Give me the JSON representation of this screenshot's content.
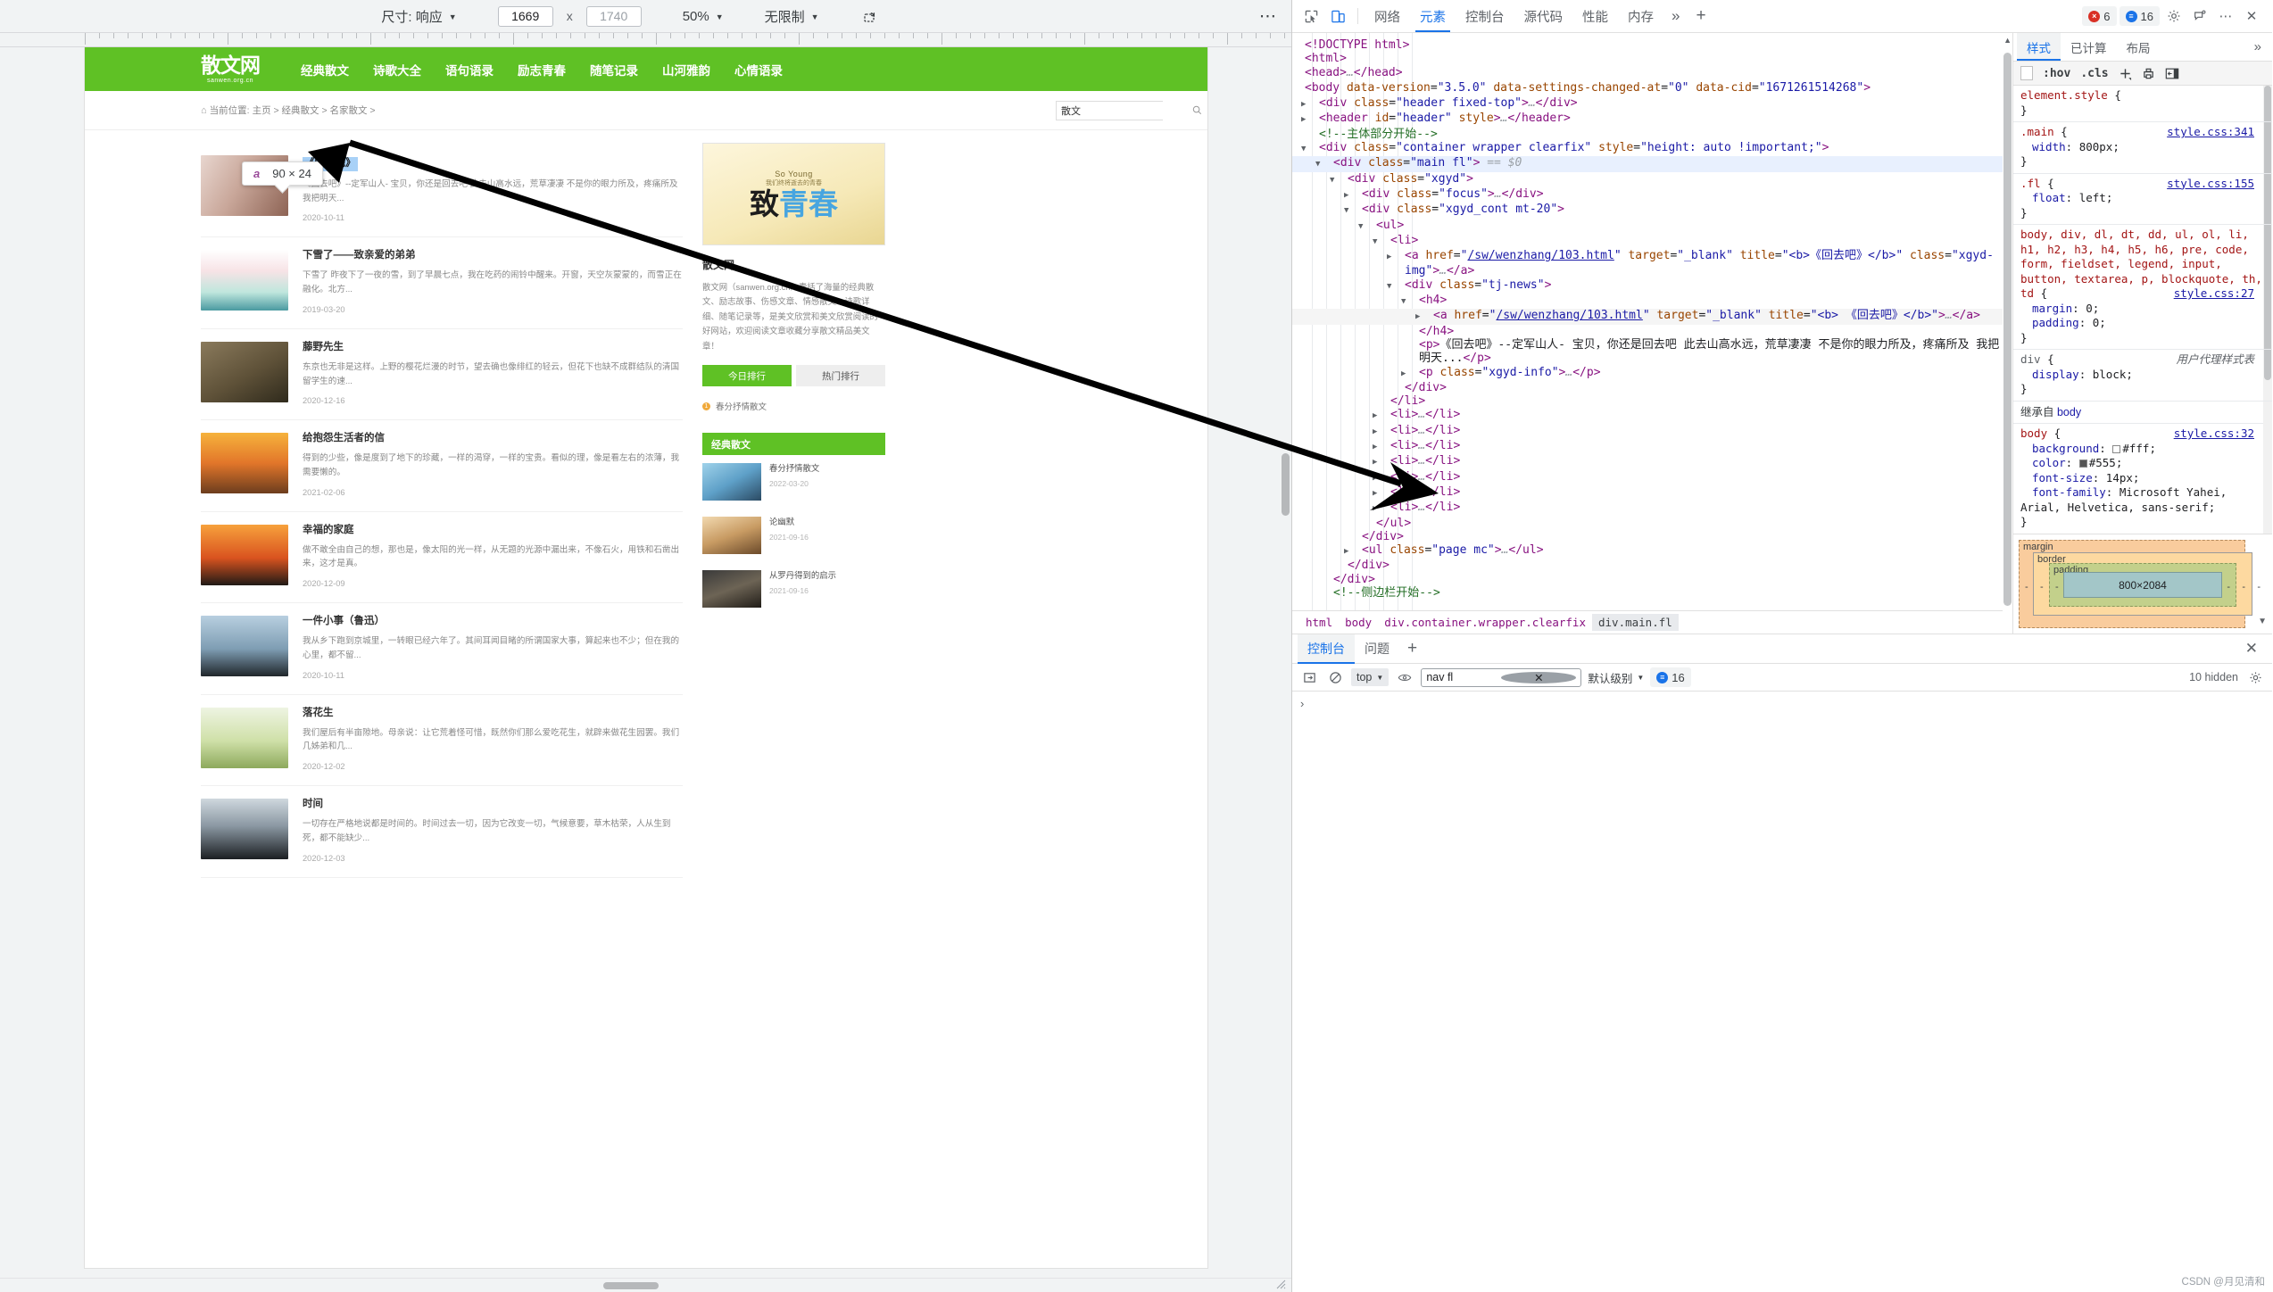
{
  "device_toolbar": {
    "size_label": "尺寸: 响应",
    "width_value": "1669",
    "height_placeholder": "1740",
    "multiply": "x",
    "zoom_label": "50%",
    "throttle_label": "无限制",
    "rotate_icon": "rotate-device-icon",
    "more_icon": "more-options-icon"
  },
  "site": {
    "logo_text": "散文网",
    "logo_domain": "sanwen.org.cn",
    "nav": [
      "经典散文",
      "诗歌大全",
      "语句语录",
      "励志青春",
      "随笔记录",
      "山河雅韵",
      "心情语录"
    ],
    "breadcrumb_prefix": "当前位置:",
    "breadcrumb": [
      "主页",
      "经典散文",
      "名家散文"
    ],
    "search_value": "散文",
    "search_icon": "search-icon",
    "articles": [
      {
        "title": "《回去吧》",
        "summary": "《回去吧》--定军山人- 宝贝，你还是回去吧 此去山高水远，荒草凄凄 不是你的眼力所及，疼痛所及 我把明天...",
        "date": "2020-10-11",
        "selected": true
      },
      {
        "title": "下雪了——致亲爱的弟弟",
        "summary": "下雪了 昨夜下了一夜的雪，到了早晨七点，我在吃药的闹铃中醒来。开窗，天空灰蒙蒙的，而雪正在融化。北方...",
        "date": "2019-03-20",
        "selected": false
      },
      {
        "title": "藤野先生",
        "summary": "东京也无非是这样。上野的樱花烂漫的时节，望去确也像绯红的轻云，但花下也缺不成群结队的清国留学生的速...",
        "date": "2020-12-16",
        "selected": false
      },
      {
        "title": "给抱怨生活者的信",
        "summary": "得到的少些，像是度到了地下的珍藏，一样的渴穿，一样的宝贵。看似的理，像是看左右的浓薄，我需要懒的。",
        "date": "2021-02-06",
        "selected": false
      },
      {
        "title": "幸福的家庭",
        "summary": "做不敢全由自己的想，那也是，像太阳的光一样，从无题的光源中漏出来，不像石火，用铁和石凿出来，这才是真。",
        "date": "2020-12-09",
        "selected": false
      },
      {
        "title": "一件小事（鲁迅）",
        "summary": "我从乡下跑到京城里，一转眼已经六年了。其间耳闻目睹的所谓国家大事，算起来也不少；但在我的心里，都不留...",
        "date": "2020-10-11",
        "selected": false
      },
      {
        "title": "落花生",
        "summary": "我们屋后有半亩隙地。母亲说：让它荒着怪可惜，既然你们那么爱吃花生，就辟来做花生园罢。我们几姊弟和几...",
        "date": "2020-12-02",
        "selected": false
      },
      {
        "title": "时间",
        "summary": "一切存在严格地说都是时间的。时间过去一切，因为它改变一切，气候意要，草木枯荣，人从生到死，都不能缺少...",
        "date": "2020-12-03",
        "selected": false
      }
    ],
    "sidebar": {
      "cover_en": "So Young",
      "cover_sub": "我们终将逝去的青春",
      "cover_title_1": "致",
      "cover_title_2": "青春",
      "title": "散文网",
      "desc": "散文网（sanwen.org.cn）囊括了海量的经典散文、励志故事、伤感文章、情感散文、诗歌详细、随笔记录等，是美文欣赏和美文欣赏阅读的好网站，欢迎阅读文章收藏分享散文精品美文章！",
      "tab_primary": "今日排行",
      "tab_secondary": "热门排行",
      "list_item": "春分抒情散文",
      "block_title": "经典散文",
      "rows": [
        {
          "title": "春分抒情散文",
          "date": "2022-03-20"
        },
        {
          "title": "论幽默",
          "date": "2021-09-16"
        },
        {
          "title": "从罗丹得到的启示",
          "date": "2021-09-16"
        }
      ]
    }
  },
  "highlight_tooltip": {
    "tag": "a",
    "dimensions": "90 × 24"
  },
  "devtools": {
    "header": {
      "inspect_icon": "inspect-element-icon",
      "device_icon": "toggle-device-toolbar-icon",
      "tabs": [
        "网络",
        "元素",
        "控制台",
        "源代码",
        "性能",
        "内存"
      ],
      "selected_tab": "元素",
      "more_tabs_icon": "more-tabs-chevron-icon",
      "add_tab_icon": "add-panel-icon",
      "error_count": "6",
      "info_count": "16",
      "settings_icon": "gear-icon",
      "feedback_icon": "feedback-icon",
      "menu_icon": "kebab-menu-icon",
      "close_icon": "close-icon"
    },
    "dom_lines": [
      {
        "indent": 0,
        "tri": "none",
        "html": "<span class=\"punct\">&lt;!DOCTYPE html&gt;</span>"
      },
      {
        "indent": 0,
        "tri": "none",
        "html": "<span class=\"punct\">&lt;</span><span class=\"tw\">html</span><span class=\"punct\">&gt;</span>"
      },
      {
        "indent": 0,
        "tri": "closed",
        "html": "<span class=\"punct\">&lt;</span><span class=\"tw\">head</span><span class=\"punct\">&gt;</span><span class=\"ghost\">…</span><span class=\"punct\">&lt;/</span><span class=\"tw\">head</span><span class=\"punct\">&gt;</span>"
      },
      {
        "indent": 0,
        "tri": "open",
        "html": "<span class=\"punct\">&lt;</span><span class=\"tw\">body</span> <span class=\"attr\">data-version</span>=<span class=\"val\">\"3.5.0\"</span> <span class=\"attr\">data-settings-changed-at</span>=<span class=\"val\">\"0\"</span> <span class=\"attr\">data-cid</span>=<span class=\"val\">\"1671261514268\"</span><span class=\"punct\">&gt;</span>"
      },
      {
        "indent": 1,
        "tri": "closed",
        "html": "<span class=\"punct\">&lt;</span><span class=\"tw\">div</span> <span class=\"attr\">class</span>=<span class=\"val\">\"header fixed-top\"</span><span class=\"punct\">&gt;</span><span class=\"ghost\">…</span><span class=\"punct\">&lt;/</span><span class=\"tw\">div</span><span class=\"punct\">&gt;</span>"
      },
      {
        "indent": 1,
        "tri": "closed",
        "html": "<span class=\"punct\">&lt;</span><span class=\"tw\">header</span> <span class=\"attr\">id</span>=<span class=\"val\">\"header\"</span> <span class=\"attr\">style</span><span class=\"punct\">&gt;</span><span class=\"ghost\">…</span><span class=\"punct\">&lt;/</span><span class=\"tw\">header</span><span class=\"punct\">&gt;</span>"
      },
      {
        "indent": 1,
        "tri": "none",
        "html": "<span class=\"cmt\">&lt;!--主体部分开始--&gt;</span>"
      },
      {
        "indent": 1,
        "tri": "open",
        "html": "<span class=\"punct\">&lt;</span><span class=\"tw\">div</span> <span class=\"attr\">class</span>=<span class=\"val\">\"container wrapper clearfix\"</span> <span class=\"attr\">style</span>=<span class=\"val\">\"height: auto !important;\"</span><span class=\"punct\">&gt;</span>"
      },
      {
        "indent": 2,
        "tri": "open",
        "sel": true,
        "dots": true,
        "html": "<span class=\"punct\">&lt;</span><span class=\"tw\">div</span> <span class=\"attr\">class</span>=<span class=\"val\">\"main fl\"</span><span class=\"punct\">&gt;</span> <span class=\"ghost\">== $0</span>"
      },
      {
        "indent": 3,
        "tri": "open",
        "html": "<span class=\"punct\">&lt;</span><span class=\"tw\">div</span> <span class=\"attr\">class</span>=<span class=\"val\">\"xgyd\"</span><span class=\"punct\">&gt;</span>"
      },
      {
        "indent": 4,
        "tri": "closed",
        "html": "<span class=\"punct\">&lt;</span><span class=\"tw\">div</span> <span class=\"attr\">class</span>=<span class=\"val\">\"focus\"</span><span class=\"punct\">&gt;</span><span class=\"ghost\">…</span><span class=\"punct\">&lt;/</span><span class=\"tw\">div</span><span class=\"punct\">&gt;</span>"
      },
      {
        "indent": 4,
        "tri": "open",
        "html": "<span class=\"punct\">&lt;</span><span class=\"tw\">div</span> <span class=\"attr\">class</span>=<span class=\"val\">\"xgyd_cont mt-20\"</span><span class=\"punct\">&gt;</span>"
      },
      {
        "indent": 5,
        "tri": "open",
        "html": "<span class=\"punct\">&lt;</span><span class=\"tw\">ul</span><span class=\"punct\">&gt;</span>"
      },
      {
        "indent": 6,
        "tri": "open",
        "html": "<span class=\"punct\">&lt;</span><span class=\"tw\">li</span><span class=\"punct\">&gt;</span>"
      },
      {
        "indent": 7,
        "tri": "closed",
        "html": "<span class=\"punct\">&lt;</span><span class=\"tw\">a</span> <span class=\"attr\">href</span>=<span class=\"val\">\"</span><span class=\"lnk\">/sw/wenzhang/103.html</span><span class=\"val\">\"</span> <span class=\"attr\">target</span>=<span class=\"val\">\"_blank\"</span> <span class=\"attr\">title</span>=<span class=\"val\">\"&lt;b&gt;《回去吧》&lt;/b&gt;\"</span> <span class=\"attr\">class</span>=<span class=\"val\">\"xgyd-img\"</span><span class=\"punct\">&gt;</span><span class=\"ghost\">…</span><span class=\"punct\">&lt;/</span><span class=\"tw\">a</span><span class=\"punct\">&gt;</span>"
      },
      {
        "indent": 7,
        "tri": "open",
        "html": "<span class=\"punct\">&lt;</span><span class=\"tw\">div</span> <span class=\"attr\">class</span>=<span class=\"val\">\"tj-news\"</span><span class=\"punct\">&gt;</span>"
      },
      {
        "indent": 8,
        "tri": "open",
        "html": "<span class=\"punct\">&lt;</span><span class=\"tw\">h4</span><span class=\"punct\">&gt;</span>"
      },
      {
        "indent": 9,
        "tri": "closed",
        "hl": true,
        "html": "<span class=\"punct\">&lt;</span><span class=\"tw\">a</span> <span class=\"attr\">href</span>=<span class=\"val\">\"</span><span class=\"lnk\">/sw/wenzhang/103.html</span><span class=\"val\">\"</span> <span class=\"attr\">target</span>=<span class=\"val\">\"_blank\"</span> <span class=\"attr\">title</span>=<span class=\"val\">\"&lt;b&gt; 《回去吧》&lt;/b&gt;\"</span><span class=\"punct\">&gt;</span><span class=\"ghost\">…</span><span class=\"punct\">&lt;/</span><span class=\"tw\">a</span><span class=\"punct\">&gt;</span>"
      },
      {
        "indent": 8,
        "tri": "none",
        "html": "<span class=\"punct\">&lt;/</span><span class=\"tw\">h4</span><span class=\"punct\">&gt;</span>"
      },
      {
        "indent": 8,
        "tri": "none",
        "html": "<span class=\"punct\">&lt;</span><span class=\"tw\">p</span><span class=\"punct\">&gt;</span><span class=\"txt\">《回去吧》--定军山人- 宝贝，你还是回去吧 此去山高水远，荒草凄凄 不是你的眼力所及，疼痛所及 我把明天...</span><span class=\"punct\">&lt;/</span><span class=\"tw\">p</span><span class=\"punct\">&gt;</span>"
      },
      {
        "indent": 8,
        "tri": "closed",
        "html": "<span class=\"punct\">&lt;</span><span class=\"tw\">p</span> <span class=\"attr\">class</span>=<span class=\"val\">\"xgyd-info\"</span><span class=\"punct\">&gt;</span><span class=\"ghost\">…</span><span class=\"punct\">&lt;/</span><span class=\"tw\">p</span><span class=\"punct\">&gt;</span>"
      },
      {
        "indent": 7,
        "tri": "none",
        "html": "<span class=\"punct\">&lt;/</span><span class=\"tw\">div</span><span class=\"punct\">&gt;</span>"
      },
      {
        "indent": 6,
        "tri": "none",
        "html": "<span class=\"punct\">&lt;/</span><span class=\"tw\">li</span><span class=\"punct\">&gt;</span>"
      },
      {
        "indent": 6,
        "tri": "closed",
        "html": "<span class=\"punct\">&lt;</span><span class=\"tw\">li</span><span class=\"punct\">&gt;</span><span class=\"ghost\">…</span><span class=\"punct\">&lt;/</span><span class=\"tw\">li</span><span class=\"punct\">&gt;</span>"
      },
      {
        "indent": 6,
        "tri": "closed",
        "html": "<span class=\"punct\">&lt;</span><span class=\"tw\">li</span><span class=\"punct\">&gt;</span><span class=\"ghost\">…</span><span class=\"punct\">&lt;/</span><span class=\"tw\">li</span><span class=\"punct\">&gt;</span>"
      },
      {
        "indent": 6,
        "tri": "closed",
        "html": "<span class=\"punct\">&lt;</span><span class=\"tw\">li</span><span class=\"punct\">&gt;</span><span class=\"ghost\">…</span><span class=\"punct\">&lt;/</span><span class=\"tw\">li</span><span class=\"punct\">&gt;</span>"
      },
      {
        "indent": 6,
        "tri": "closed",
        "html": "<span class=\"punct\">&lt;</span><span class=\"tw\">li</span><span class=\"punct\">&gt;</span><span class=\"ghost\">…</span><span class=\"punct\">&lt;/</span><span class=\"tw\">li</span><span class=\"punct\">&gt;</span>"
      },
      {
        "indent": 6,
        "tri": "closed",
        "html": "<span class=\"punct\">&lt;</span><span class=\"tw\">li</span><span class=\"punct\">&gt;</span><span class=\"ghost\">…</span><span class=\"punct\">&lt;/</span><span class=\"tw\">li</span><span class=\"punct\">&gt;</span>"
      },
      {
        "indent": 6,
        "tri": "closed",
        "html": "<span class=\"punct\">&lt;</span><span class=\"tw\">li</span><span class=\"punct\">&gt;</span><span class=\"ghost\">…</span><span class=\"punct\">&lt;/</span><span class=\"tw\">li</span><span class=\"punct\">&gt;</span>"
      },
      {
        "indent": 6,
        "tri": "closed",
        "html": "<span class=\"punct\">&lt;</span><span class=\"tw\">li</span><span class=\"punct\">&gt;</span><span class=\"ghost\">…</span><span class=\"punct\">&lt;/</span><span class=\"tw\">li</span><span class=\"punct\">&gt;</span>"
      },
      {
        "indent": 5,
        "tri": "none",
        "html": "<span class=\"punct\">&lt;/</span><span class=\"tw\">ul</span><span class=\"punct\">&gt;</span>"
      },
      {
        "indent": 4,
        "tri": "none",
        "html": "<span class=\"punct\">&lt;/</span><span class=\"tw\">div</span><span class=\"punct\">&gt;</span>"
      },
      {
        "indent": 4,
        "tri": "closed",
        "html": "<span class=\"punct\">&lt;</span><span class=\"tw\">ul</span> <span class=\"attr\">class</span>=<span class=\"val\">\"page mc\"</span><span class=\"punct\">&gt;</span><span class=\"ghost\">…</span><span class=\"punct\">&lt;/</span><span class=\"tw\">ul</span><span class=\"punct\">&gt;</span>"
      },
      {
        "indent": 3,
        "tri": "none",
        "html": "<span class=\"punct\">&lt;/</span><span class=\"tw\">div</span><span class=\"punct\">&gt;</span>"
      },
      {
        "indent": 2,
        "tri": "none",
        "html": "<span class=\"punct\">&lt;/</span><span class=\"tw\">div</span><span class=\"punct\">&gt;</span>"
      },
      {
        "indent": 2,
        "tri": "none",
        "html": "<span class=\"cmt\">&lt;!--侧边栏开始--&gt;</span>"
      }
    ],
    "breadcrumbs": [
      "html",
      "body",
      "div.container.wrapper.clearfix",
      "div.main.fl"
    ],
    "breadcrumb_selected": "div.main.fl",
    "styles": {
      "tabs": [
        "样式",
        "已计算",
        "布局"
      ],
      "selected_tab": "样式",
      "more_icon": "more-panels-chevron-icon",
      "toolbar": {
        "hov": ":hov",
        "cls": ".cls",
        "new_rule_icon": "add-style-rule-icon",
        "print_icon": "print-media-icon",
        "sidebar_icon": "computed-sidebar-icon"
      },
      "rules": [
        {
          "selector": "element.style",
          "source": "",
          "decls": []
        },
        {
          "selector": ".main",
          "source": "style.css:341",
          "decls": [
            {
              "prop": "width",
              "value": "800px"
            }
          ]
        },
        {
          "selector": ".fl",
          "source": "style.css:155",
          "decls": [
            {
              "prop": "float",
              "value": "left"
            }
          ]
        },
        {
          "selector": "body, div, dl, dt, dd, ul, ol, li, h1, h2, h3, h4, h5, h6, pre, code, form, fieldset, legend, input, button, textarea, p, blockquote, th, td",
          "source": "style.css:27",
          "decls": [
            {
              "prop": "margin",
              "value": "0"
            },
            {
              "prop": "padding",
              "value": "0"
            }
          ]
        },
        {
          "selector": "div",
          "source": "用户代理样式表",
          "ua": true,
          "decls": [
            {
              "prop": "display",
              "value": "block"
            }
          ]
        }
      ],
      "inherited_label": "继承自",
      "inherited_from": "body",
      "inherited_rule": {
        "selector": "body",
        "source": "style.css:32",
        "decls": [
          {
            "prop": "background",
            "value": "#fff",
            "swatch": "#ffffff"
          },
          {
            "prop": "color",
            "value": "#555",
            "swatch": "#555555"
          },
          {
            "prop": "font-size",
            "value": "14px"
          },
          {
            "prop": "font-family",
            "value": "Microsoft Yahei, Arial, Helvetica, sans-serif"
          }
        ]
      }
    },
    "box_model": {
      "margin_label": "margin",
      "border_label": "border",
      "padding_label": "padding",
      "content_size": "800×2084",
      "dash": "-"
    },
    "drawer": {
      "tabs": [
        "控制台",
        "问题"
      ],
      "selected_tab": "控制台",
      "add_icon": "add-drawer-tab-icon",
      "close_icon": "close-drawer-icon",
      "console": {
        "sidebar_icon": "console-sidebar-icon",
        "clear_icon": "clear-console-icon",
        "context": "top",
        "eye_icon": "live-expression-icon",
        "filter_value": "nav fl",
        "clear_filter_icon": "clear-filter-icon",
        "level": "默认级别",
        "info_count": "16",
        "hidden_label": "10 hidden",
        "settings_icon": "console-settings-icon",
        "prompt": "›"
      }
    }
  },
  "watermark": "CSDN @月见清和"
}
